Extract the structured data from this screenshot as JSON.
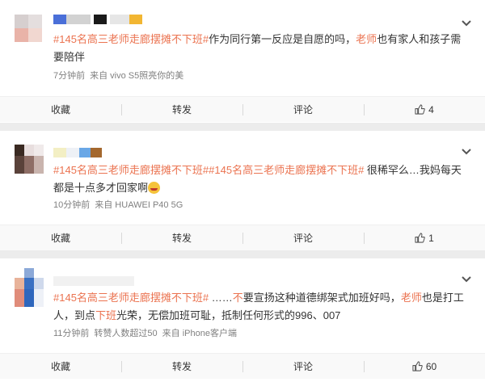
{
  "posts": [
    {
      "username_blurred": "平翻广小威心",
      "text": {
        "topic": "#145名高三老师走廊摆摊不下班#",
        "part1": "作为同行第一反应是自愿的吗，",
        "kw": "老师",
        "part2": "也有家人和孩子需要陪伴"
      },
      "meta": {
        "time": "7分钟前",
        "source": "来自 vivo S5照亮你的美"
      },
      "actions": {
        "favorite": "收藏",
        "repost": "转发",
        "comment": "评论",
        "likes": "4"
      }
    },
    {
      "text": {
        "topic1": "#145名高三老师走廊摆摊不下班#",
        "topic2": "#145名高三老师走廊摆摊不下班#",
        "part1": " 很稀罕么…我妈每天都是十点多才回家啊"
      },
      "meta": {
        "time": "10分钟前",
        "source": "来自 HUAWEI P40 5G"
      },
      "actions": {
        "favorite": "收藏",
        "repost": "转发",
        "comment": "评论",
        "likes": "1"
      }
    },
    {
      "text": {
        "topic": "#145名高三老师走廊摆摊不下班#",
        "part1": " ……",
        "kw1": "不",
        "part2": "要宣扬这种道德绑架式加班好吗，",
        "kw2": "老师",
        "part3": "也是打工人，到点",
        "kw3": "下班",
        "part4": "光荣，无偿加班可耻，抵制任何形式的996、007"
      },
      "meta": {
        "time": "11分钟前",
        "reposts": "转赞人数超过50",
        "source": "来自 iPhone客户端"
      },
      "actions": {
        "favorite": "收藏",
        "repost": "转发",
        "comment": "评论",
        "likes": "60"
      }
    }
  ],
  "icons": {
    "more": "chevron-down-icon",
    "like": "thumbs-up-icon",
    "emoji": "laughing-emoji-icon"
  },
  "colors": {
    "topic": "#eb7350",
    "meta": "#808080",
    "background": "#ececec"
  }
}
